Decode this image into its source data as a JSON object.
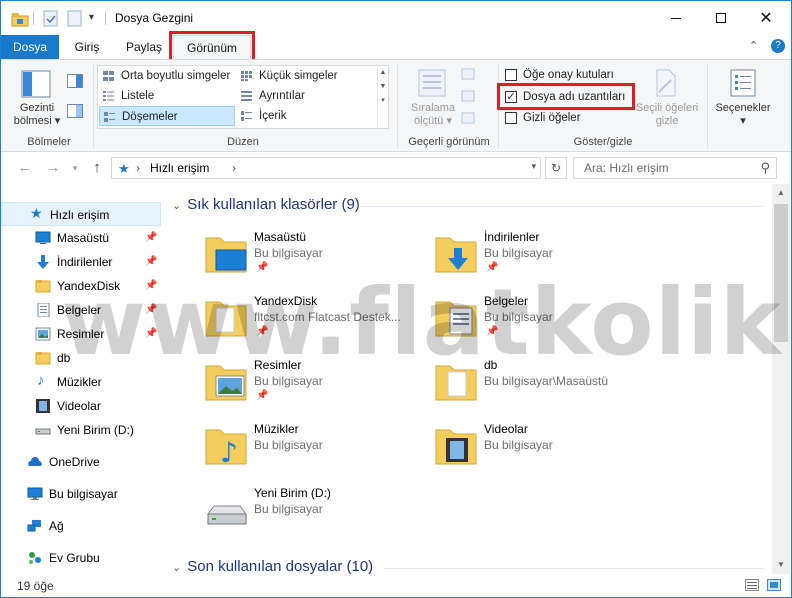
{
  "window": {
    "title": "Dosya Gezgini"
  },
  "ribbon_tabs": [
    {
      "label": "Dosya"
    },
    {
      "label": "Giriş"
    },
    {
      "label": "Paylaş"
    },
    {
      "label": "Görünüm"
    }
  ],
  "ribbon": {
    "panes": {
      "nav_pane_label_1": "Gezinti",
      "nav_pane_label_2": "bölmesi",
      "group": "Bölmeler"
    },
    "layout": {
      "items": [
        {
          "label": "Orta boyutlu simgeler"
        },
        {
          "label": "Küçük simgeler"
        },
        {
          "label": "Listele"
        },
        {
          "label": "Ayrıntılar"
        },
        {
          "label": "Döşemeler"
        },
        {
          "label": "İçerik"
        }
      ],
      "group": "Düzen"
    },
    "current_view": {
      "sort_label_1": "Sıralama",
      "sort_label_2": "ölçütü",
      "group": "Geçerli görünüm"
    },
    "show_hide": {
      "item_checkboxes": "Öğe onay kutuları",
      "file_extensions": "Dosya adı uzantıları",
      "hidden_items": "Gizli öğeler",
      "hide_selected_1": "Seçili öğeleri",
      "hide_selected_2": "gizle",
      "group": "Göster/gizle"
    },
    "options": {
      "label": "Seçenekler"
    }
  },
  "address": {
    "path": "Hızlı erişim",
    "search_placeholder": "Ara: Hızlı erişim"
  },
  "nav": {
    "items": [
      {
        "label": "Hızlı erişim"
      },
      {
        "label": "Masaüstü"
      },
      {
        "label": "İndirilenler"
      },
      {
        "label": "YandexDisk"
      },
      {
        "label": "Belgeler"
      },
      {
        "label": "Resimler"
      },
      {
        "label": "db"
      },
      {
        "label": "Müzikler"
      },
      {
        "label": "Videolar"
      },
      {
        "label": "Yeni Birim (D:)"
      },
      {
        "label": "OneDrive"
      },
      {
        "label": "Bu bilgisayar"
      },
      {
        "label": "Ağ"
      },
      {
        "label": "Ev Grubu"
      }
    ]
  },
  "main": {
    "frequent_header": "Sık kullanılan klasörler (9)",
    "recent_header": "Son kullanılan dosyalar (10)",
    "folders": [
      {
        "name": "Masaüstü",
        "sub": "Bu bilgisayar"
      },
      {
        "name": "İndirilenler",
        "sub": "Bu bilgisayar"
      },
      {
        "name": "YandexDisk",
        "sub": "fltcst.com Flatcast Destek..."
      },
      {
        "name": "Belgeler",
        "sub": "Bu bilgisayar"
      },
      {
        "name": "Resimler",
        "sub": "Bu bilgisayar"
      },
      {
        "name": "db",
        "sub": "Bu bilgisayar\\Masaüstü"
      },
      {
        "name": "Müzikler",
        "sub": "Bu bilgisayar"
      },
      {
        "name": "Videolar",
        "sub": "Bu bilgisayar"
      },
      {
        "name": "Yeni Birim (D:)",
        "sub": "Bu bilgisayar"
      }
    ]
  },
  "status": {
    "count": "19 öğe"
  },
  "watermark": "www.flatkolik.net",
  "colors": {
    "accent": "#1979ca",
    "highlight": "#e01c24",
    "folder": "#f3cd5e",
    "selection": "#cce8ff"
  }
}
